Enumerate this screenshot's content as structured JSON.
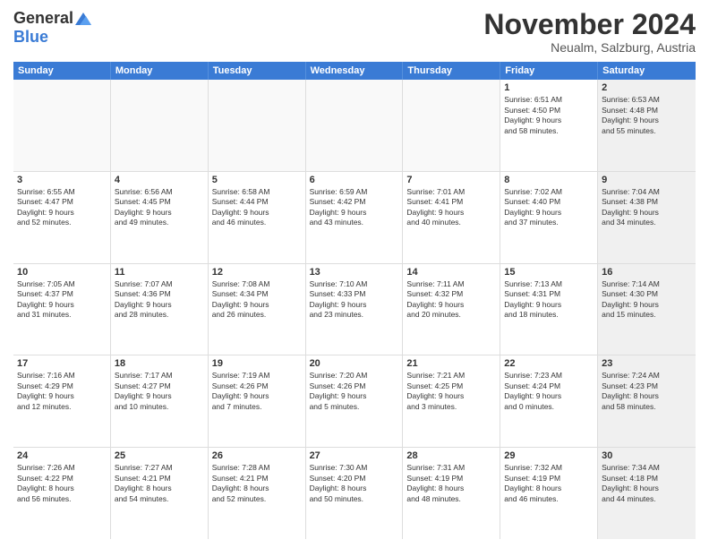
{
  "logo": {
    "general": "General",
    "blue": "Blue"
  },
  "title": "November 2024",
  "subtitle": "Neualm, Salzburg, Austria",
  "days_of_week": [
    "Sunday",
    "Monday",
    "Tuesday",
    "Wednesday",
    "Thursday",
    "Friday",
    "Saturday"
  ],
  "weeks": [
    [
      {
        "day": "",
        "info": "",
        "empty": true
      },
      {
        "day": "",
        "info": "",
        "empty": true
      },
      {
        "day": "",
        "info": "",
        "empty": true
      },
      {
        "day": "",
        "info": "",
        "empty": true
      },
      {
        "day": "",
        "info": "",
        "empty": true
      },
      {
        "day": "1",
        "info": "Sunrise: 6:51 AM\nSunset: 4:50 PM\nDaylight: 9 hours\nand 58 minutes."
      },
      {
        "day": "2",
        "info": "Sunrise: 6:53 AM\nSunset: 4:48 PM\nDaylight: 9 hours\nand 55 minutes.",
        "shaded": true
      }
    ],
    [
      {
        "day": "3",
        "info": "Sunrise: 6:55 AM\nSunset: 4:47 PM\nDaylight: 9 hours\nand 52 minutes."
      },
      {
        "day": "4",
        "info": "Sunrise: 6:56 AM\nSunset: 4:45 PM\nDaylight: 9 hours\nand 49 minutes."
      },
      {
        "day": "5",
        "info": "Sunrise: 6:58 AM\nSunset: 4:44 PM\nDaylight: 9 hours\nand 46 minutes."
      },
      {
        "day": "6",
        "info": "Sunrise: 6:59 AM\nSunset: 4:42 PM\nDaylight: 9 hours\nand 43 minutes."
      },
      {
        "day": "7",
        "info": "Sunrise: 7:01 AM\nSunset: 4:41 PM\nDaylight: 9 hours\nand 40 minutes."
      },
      {
        "day": "8",
        "info": "Sunrise: 7:02 AM\nSunset: 4:40 PM\nDaylight: 9 hours\nand 37 minutes."
      },
      {
        "day": "9",
        "info": "Sunrise: 7:04 AM\nSunset: 4:38 PM\nDaylight: 9 hours\nand 34 minutes.",
        "shaded": true
      }
    ],
    [
      {
        "day": "10",
        "info": "Sunrise: 7:05 AM\nSunset: 4:37 PM\nDaylight: 9 hours\nand 31 minutes."
      },
      {
        "day": "11",
        "info": "Sunrise: 7:07 AM\nSunset: 4:36 PM\nDaylight: 9 hours\nand 28 minutes."
      },
      {
        "day": "12",
        "info": "Sunrise: 7:08 AM\nSunset: 4:34 PM\nDaylight: 9 hours\nand 26 minutes."
      },
      {
        "day": "13",
        "info": "Sunrise: 7:10 AM\nSunset: 4:33 PM\nDaylight: 9 hours\nand 23 minutes."
      },
      {
        "day": "14",
        "info": "Sunrise: 7:11 AM\nSunset: 4:32 PM\nDaylight: 9 hours\nand 20 minutes."
      },
      {
        "day": "15",
        "info": "Sunrise: 7:13 AM\nSunset: 4:31 PM\nDaylight: 9 hours\nand 18 minutes."
      },
      {
        "day": "16",
        "info": "Sunrise: 7:14 AM\nSunset: 4:30 PM\nDaylight: 9 hours\nand 15 minutes.",
        "shaded": true
      }
    ],
    [
      {
        "day": "17",
        "info": "Sunrise: 7:16 AM\nSunset: 4:29 PM\nDaylight: 9 hours\nand 12 minutes."
      },
      {
        "day": "18",
        "info": "Sunrise: 7:17 AM\nSunset: 4:27 PM\nDaylight: 9 hours\nand 10 minutes."
      },
      {
        "day": "19",
        "info": "Sunrise: 7:19 AM\nSunset: 4:26 PM\nDaylight: 9 hours\nand 7 minutes."
      },
      {
        "day": "20",
        "info": "Sunrise: 7:20 AM\nSunset: 4:26 PM\nDaylight: 9 hours\nand 5 minutes."
      },
      {
        "day": "21",
        "info": "Sunrise: 7:21 AM\nSunset: 4:25 PM\nDaylight: 9 hours\nand 3 minutes."
      },
      {
        "day": "22",
        "info": "Sunrise: 7:23 AM\nSunset: 4:24 PM\nDaylight: 9 hours\nand 0 minutes."
      },
      {
        "day": "23",
        "info": "Sunrise: 7:24 AM\nSunset: 4:23 PM\nDaylight: 8 hours\nand 58 minutes.",
        "shaded": true
      }
    ],
    [
      {
        "day": "24",
        "info": "Sunrise: 7:26 AM\nSunset: 4:22 PM\nDaylight: 8 hours\nand 56 minutes."
      },
      {
        "day": "25",
        "info": "Sunrise: 7:27 AM\nSunset: 4:21 PM\nDaylight: 8 hours\nand 54 minutes."
      },
      {
        "day": "26",
        "info": "Sunrise: 7:28 AM\nSunset: 4:21 PM\nDaylight: 8 hours\nand 52 minutes."
      },
      {
        "day": "27",
        "info": "Sunrise: 7:30 AM\nSunset: 4:20 PM\nDaylight: 8 hours\nand 50 minutes."
      },
      {
        "day": "28",
        "info": "Sunrise: 7:31 AM\nSunset: 4:19 PM\nDaylight: 8 hours\nand 48 minutes."
      },
      {
        "day": "29",
        "info": "Sunrise: 7:32 AM\nSunset: 4:19 PM\nDaylight: 8 hours\nand 46 minutes."
      },
      {
        "day": "30",
        "info": "Sunrise: 7:34 AM\nSunset: 4:18 PM\nDaylight: 8 hours\nand 44 minutes.",
        "shaded": true
      }
    ]
  ]
}
